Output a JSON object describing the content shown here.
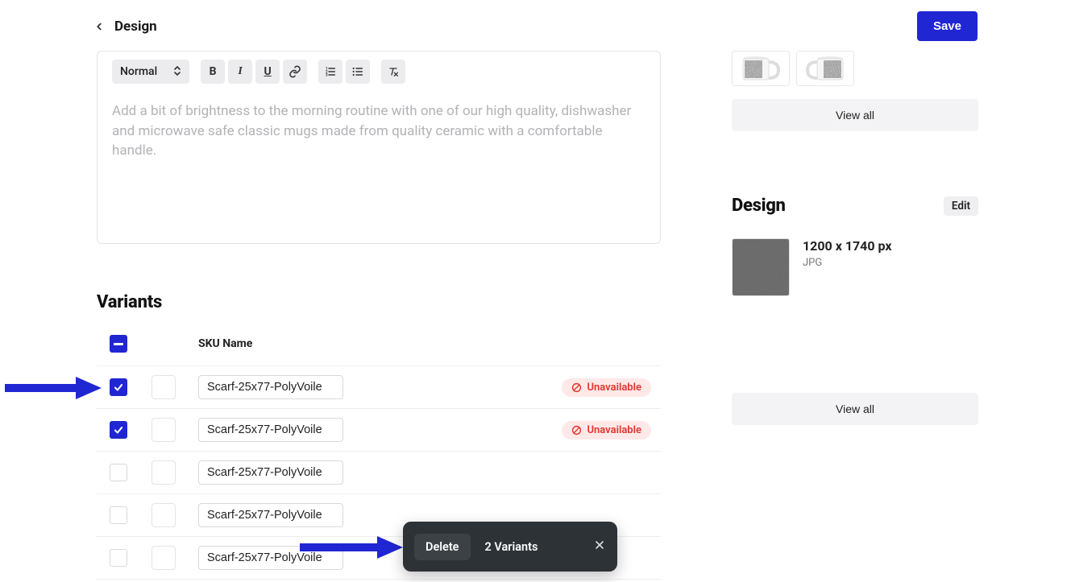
{
  "header": {
    "title": "Design",
    "save_label": "Save"
  },
  "editor": {
    "format_label": "Normal",
    "description_text": "Add a bit of brightness to the morning routine with one of our high quality, dishwasher and microwave safe classic mugs made from quality ceramic with a comfortable handle."
  },
  "variants": {
    "heading": "Variants",
    "sku_header": "SKU Name",
    "rows": [
      {
        "sku": "Scarf-25x77-PolyVoile",
        "checked": true,
        "status": "Unavailable"
      },
      {
        "sku": "Scarf-25x77-PolyVoile",
        "checked": true,
        "status": "Unavailable"
      },
      {
        "sku": "Scarf-25x77-PolyVoile",
        "checked": false,
        "status": ""
      },
      {
        "sku": "Scarf-25x77-PolyVoile",
        "checked": false,
        "status": ""
      },
      {
        "sku": "Scarf-25x77-PolyVoile",
        "checked": false,
        "status": ""
      }
    ]
  },
  "sidebar": {
    "view_all_label": "View all",
    "design_heading": "Design",
    "edit_label": "Edit",
    "design_dims": "1200 x 1740 px",
    "design_format": "JPG",
    "view_all_label2": "View all"
  },
  "toast": {
    "delete_label": "Delete",
    "count_label": "2 Variants"
  }
}
